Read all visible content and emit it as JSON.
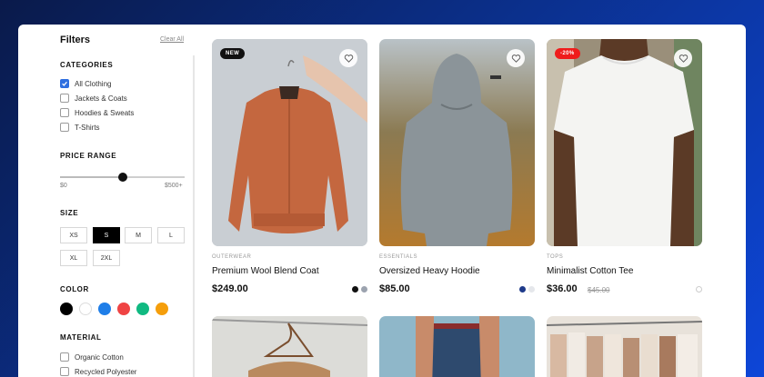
{
  "sidebar": {
    "title": "Filters",
    "clear_all": "Clear All",
    "categories": {
      "title": "CATEGORIES",
      "items": [
        {
          "label": "All Clothing",
          "checked": true
        },
        {
          "label": "Jackets & Coats",
          "checked": false
        },
        {
          "label": "Hoodies & Sweats",
          "checked": false
        },
        {
          "label": "T-Shirts",
          "checked": false
        }
      ]
    },
    "price_range": {
      "title": "PRICE RANGE",
      "min_label": "$0",
      "max_label": "$500+",
      "value_fraction": 0.5
    },
    "size": {
      "title": "SIZE",
      "options": [
        "XS",
        "S",
        "M",
        "L",
        "XL",
        "2XL"
      ],
      "selected": "S"
    },
    "color": {
      "title": "COLOR",
      "swatches": [
        "#000000",
        "#ffffff",
        "#1f7ee8",
        "#ef4444",
        "#10b981",
        "#f59e0b"
      ]
    },
    "material": {
      "title": "MATERIAL",
      "items": [
        {
          "label": "Organic Cotton",
          "checked": false
        },
        {
          "label": "Recycled Polyester",
          "checked": false
        }
      ]
    }
  },
  "products": [
    {
      "badge": "NEW",
      "badge_color": "#111111",
      "category": "OUTERWEAR",
      "name": "Premium Wool Blend Coat",
      "price": "$249.00",
      "old_price": "",
      "colors": [
        "#111111",
        "#9ca3af"
      ]
    },
    {
      "badge": "",
      "badge_color": "",
      "category": "ESSENTIALS",
      "name": "Oversized Heavy Hoodie",
      "price": "$85.00",
      "old_price": "",
      "colors": [
        "#1e3a8a",
        "#e5e7eb"
      ]
    },
    {
      "badge": "-20%",
      "badge_color": "#ef1c1c",
      "category": "TOPS",
      "name": "Minimalist Cotton Tee",
      "price": "$36.00",
      "old_price": "$45.00",
      "colors": [
        "#ffffff"
      ]
    }
  ]
}
